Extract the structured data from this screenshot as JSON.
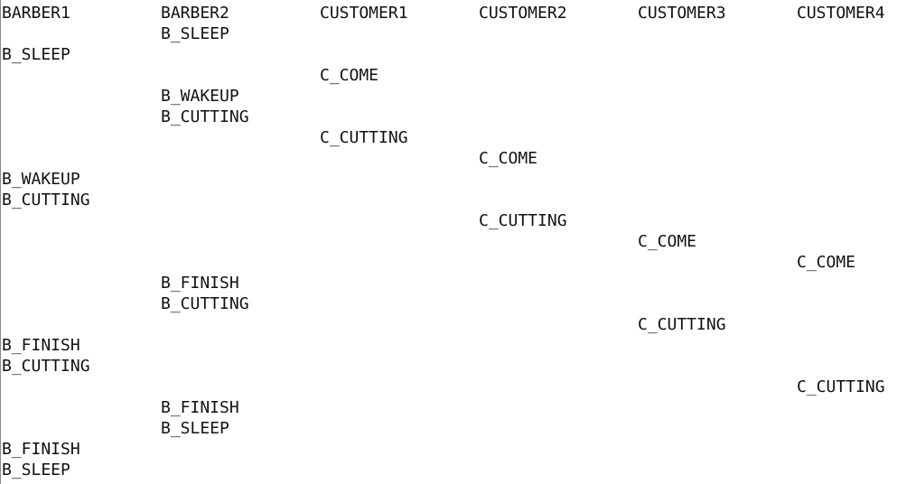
{
  "header": {
    "columns": [
      "BARBER1",
      "BARBER2",
      "CUSTOMER1",
      "CUSTOMER2",
      "CUSTOMER3",
      "CUSTOMER4"
    ]
  },
  "log": {
    "rows": [
      {
        "barber1": "",
        "barber2": "B_SLEEP",
        "customer1": "",
        "customer2": "",
        "customer3": "",
        "customer4": ""
      },
      {
        "barber1": "B_SLEEP",
        "barber2": "",
        "customer1": "",
        "customer2": "",
        "customer3": "",
        "customer4": ""
      },
      {
        "barber1": "",
        "barber2": "",
        "customer1": "C_COME",
        "customer2": "",
        "customer3": "",
        "customer4": ""
      },
      {
        "barber1": "",
        "barber2": "B_WAKEUP",
        "customer1": "",
        "customer2": "",
        "customer3": "",
        "customer4": ""
      },
      {
        "barber1": "",
        "barber2": "B_CUTTING",
        "customer1": "",
        "customer2": "",
        "customer3": "",
        "customer4": ""
      },
      {
        "barber1": "",
        "barber2": "",
        "customer1": "C_CUTTING",
        "customer2": "",
        "customer3": "",
        "customer4": ""
      },
      {
        "barber1": "",
        "barber2": "",
        "customer1": "",
        "customer2": "C_COME",
        "customer3": "",
        "customer4": ""
      },
      {
        "barber1": "B_WAKEUP",
        "barber2": "",
        "customer1": "",
        "customer2": "",
        "customer3": "",
        "customer4": ""
      },
      {
        "barber1": "B_CUTTING",
        "barber2": "",
        "customer1": "",
        "customer2": "",
        "customer3": "",
        "customer4": ""
      },
      {
        "barber1": "",
        "barber2": "",
        "customer1": "",
        "customer2": "C_CUTTING",
        "customer3": "",
        "customer4": ""
      },
      {
        "barber1": "",
        "barber2": "",
        "customer1": "",
        "customer2": "",
        "customer3": "C_COME",
        "customer4": ""
      },
      {
        "barber1": "",
        "barber2": "",
        "customer1": "",
        "customer2": "",
        "customer3": "",
        "customer4": "C_COME"
      },
      {
        "barber1": "",
        "barber2": "B_FINISH",
        "customer1": "",
        "customer2": "",
        "customer3": "",
        "customer4": ""
      },
      {
        "barber1": "",
        "barber2": "B_CUTTING",
        "customer1": "",
        "customer2": "",
        "customer3": "",
        "customer4": ""
      },
      {
        "barber1": "",
        "barber2": "",
        "customer1": "",
        "customer2": "",
        "customer3": "C_CUTTING",
        "customer4": ""
      },
      {
        "barber1": "B_FINISH",
        "barber2": "",
        "customer1": "",
        "customer2": "",
        "customer3": "",
        "customer4": ""
      },
      {
        "barber1": "B_CUTTING",
        "barber2": "",
        "customer1": "",
        "customer2": "",
        "customer3": "",
        "customer4": ""
      },
      {
        "barber1": "",
        "barber2": "",
        "customer1": "",
        "customer2": "",
        "customer3": "",
        "customer4": "C_CUTTING"
      },
      {
        "barber1": "",
        "barber2": "B_FINISH",
        "customer1": "",
        "customer2": "",
        "customer3": "",
        "customer4": ""
      },
      {
        "barber1": "",
        "barber2": "B_SLEEP",
        "customer1": "",
        "customer2": "",
        "customer3": "",
        "customer4": ""
      },
      {
        "barber1": "B_FINISH",
        "barber2": "",
        "customer1": "",
        "customer2": "",
        "customer3": "",
        "customer4": ""
      },
      {
        "barber1": "B_SLEEP",
        "barber2": "",
        "customer1": "",
        "customer2": "",
        "customer3": "",
        "customer4": ""
      }
    ]
  }
}
